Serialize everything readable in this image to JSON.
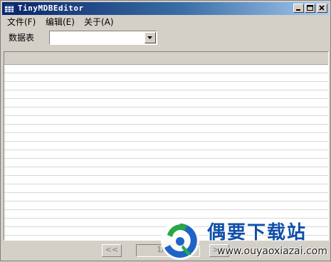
{
  "window": {
    "title": "TinyMDBEditor"
  },
  "menu": {
    "items": [
      {
        "label": "文件(F)"
      },
      {
        "label": "编辑(E)"
      },
      {
        "label": "关于(A)"
      }
    ]
  },
  "toolbar": {
    "table_label": "数据表",
    "table_selected": ""
  },
  "pager": {
    "prev_label": "<<",
    "page_text": "1/100",
    "next_label": ">>"
  },
  "watermark": {
    "title": "偶要下载站",
    "url": "www.ouyaoxiazai.com"
  }
}
